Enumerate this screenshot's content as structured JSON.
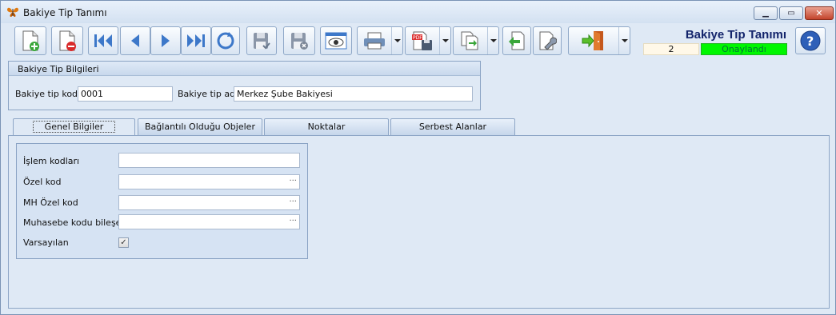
{
  "window": {
    "title": "Bakiye Tip Tanımı"
  },
  "toolbar": {
    "buttons": [
      "new-record",
      "delete-record",
      "first",
      "previous",
      "next",
      "last",
      "refresh",
      "save",
      "cancel",
      "preview",
      "print",
      "export-pdf",
      "copy",
      "import",
      "tools",
      "exit",
      "help"
    ]
  },
  "header": {
    "title": "Bakiye Tip Tanımı",
    "record_number": "2",
    "status": "Onaylandı",
    "status_color": "#00f700"
  },
  "info_group": {
    "title": "Bakiye Tip Bilgileri",
    "code_label": "Bakiye tip kodu",
    "code_value": "0001",
    "name_label": "Bakiye tip adı",
    "name_value": "Merkez Şube Bakiyesi"
  },
  "tabs": [
    {
      "label": "Genel Bilgiler",
      "active": true
    },
    {
      "label": "Bağlantılı Olduğu Objeler",
      "active": false
    },
    {
      "label": "Noktalar",
      "active": false
    },
    {
      "label": "Serbest Alanlar",
      "active": false
    }
  ],
  "general": {
    "fields": [
      {
        "label": "İşlem kodları",
        "value": ""
      },
      {
        "label": "Özel kod",
        "value": "",
        "ellipsis": "···"
      },
      {
        "label": "MH Özel kod",
        "value": "",
        "ellipsis": "···"
      },
      {
        "label": "Muhasebe kodu bileşeni",
        "value": "",
        "ellipsis": "···"
      }
    ],
    "default_label": "Varsayılan",
    "default_checked": "✓"
  }
}
